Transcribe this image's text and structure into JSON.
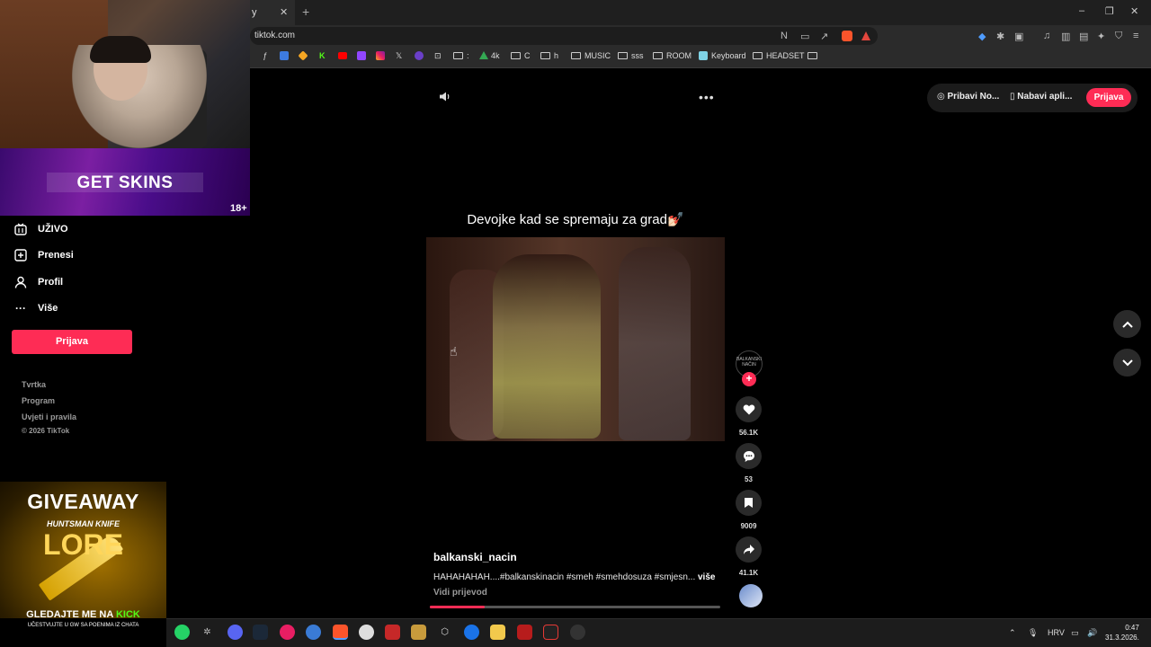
{
  "browser": {
    "tab_title": "y",
    "tab_close": "✕",
    "new_tab": "+",
    "url": "tiktok.com",
    "window_controls": [
      "–",
      "❐",
      "✕"
    ],
    "bookmarks": {
      "item_colon": ":",
      "item_4k": "4k",
      "item_c": "C",
      "item_h": "h",
      "music": "MUSIC",
      "sss": "sss",
      "room": "ROOM",
      "keyboard": "Keyboard",
      "headset": "HEADSET"
    }
  },
  "stream_overlay": {
    "skins_banner": "GET SKINS",
    "age_badge": "18+",
    "giveaway": {
      "title": "GIVEAWAY",
      "subtitle": "HUNTSMAN KNIFE",
      "skin": "LORE",
      "watch_prefix": "GLEDAJTE ME NA ",
      "watch_platform": "KICK",
      "note": "UČESTVUJTE U GW SA POENIMA IZ CHATA"
    }
  },
  "sidebar": {
    "items": [
      {
        "label": "UŽIVO",
        "icon": "live-icon"
      },
      {
        "label": "Prenesi",
        "icon": "upload-icon"
      },
      {
        "label": "Profil",
        "icon": "profile-icon"
      },
      {
        "label": "Više",
        "icon": "more-icon"
      }
    ],
    "login_label": "Prijava",
    "footer": [
      "Tvrtka",
      "Program",
      "Uvjeti i pravila",
      "© 2026 TikTok"
    ]
  },
  "header": {
    "get_coins": "Pribavi No...",
    "get_app": "Nabavi apli...",
    "login": "Prijava"
  },
  "video": {
    "caption": "Devojke kad se spremaju za grad💅🏻",
    "creator_avatar_text": "BALKANSKI NAČIN",
    "author": "balkanski_nacin",
    "description": "HAHAHAHAH....#balkanskinacin #smeh #smehdosuza #smjesn...",
    "more": "više",
    "translate": "Vidi prijevod",
    "progress": 0.19,
    "likes": "56.1K",
    "comments": "53",
    "saves": "9009",
    "shares": "41.1K"
  },
  "taskbar": {
    "language": "HRV",
    "time": "0:47",
    "date": "31.3.2026."
  },
  "colors": {
    "accent": "#fe2c55",
    "kick": "#53fc18"
  }
}
